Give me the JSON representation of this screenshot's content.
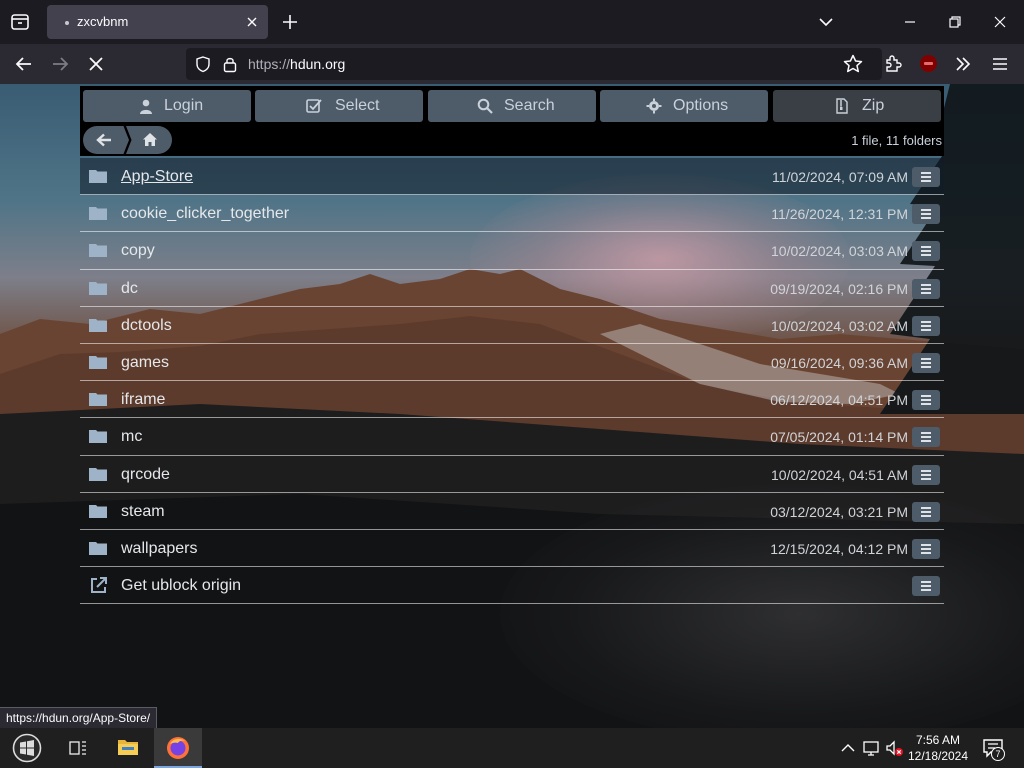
{
  "browser": {
    "tab_title": "zxcvbnm",
    "url_scheme": "https://",
    "url_host": "hdun.org"
  },
  "toolbar": {
    "buttons": [
      {
        "label": "Login",
        "icon": "user-icon"
      },
      {
        "label": "Select",
        "icon": "checkbox-icon"
      },
      {
        "label": "Search",
        "icon": "search-icon"
      },
      {
        "label": "Options",
        "icon": "gear-icon"
      },
      {
        "label": "Zip",
        "icon": "file-zip-icon"
      }
    ],
    "count_text": "1 file, 11 folders"
  },
  "files": [
    {
      "name": "App-Store",
      "date": "11/02/2024, 07:09 AM",
      "type": "folder"
    },
    {
      "name": "cookie_clicker_together",
      "date": "11/26/2024, 12:31 PM",
      "type": "folder"
    },
    {
      "name": "copy",
      "date": "10/02/2024, 03:03 AM",
      "type": "folder"
    },
    {
      "name": "dc",
      "date": "09/19/2024, 02:16 PM",
      "type": "folder"
    },
    {
      "name": "dctools",
      "date": "10/02/2024, 03:02 AM",
      "type": "folder"
    },
    {
      "name": "games",
      "date": "09/16/2024, 09:36 AM",
      "type": "folder"
    },
    {
      "name": "iframe",
      "date": "06/12/2024, 04:51 PM",
      "type": "folder"
    },
    {
      "name": "mc",
      "date": "07/05/2024, 01:14 PM",
      "type": "folder"
    },
    {
      "name": "qrcode",
      "date": "10/02/2024, 04:51 AM",
      "type": "folder"
    },
    {
      "name": "steam",
      "date": "03/12/2024, 03:21 PM",
      "type": "folder"
    },
    {
      "name": "wallpapers",
      "date": "12/15/2024, 04:12 PM",
      "type": "folder"
    },
    {
      "name": "Get ublock origin",
      "date": "",
      "type": "link"
    }
  ],
  "status_url": "https://hdun.org/App-Store/",
  "taskbar": {
    "time": "7:56 AM",
    "date": "12/18/2024",
    "notification_count": "7"
  },
  "colors": {
    "button_bg": "#4e5b69",
    "toolbar_bg": "#000000",
    "folder_icon": "#9fb3c8"
  }
}
